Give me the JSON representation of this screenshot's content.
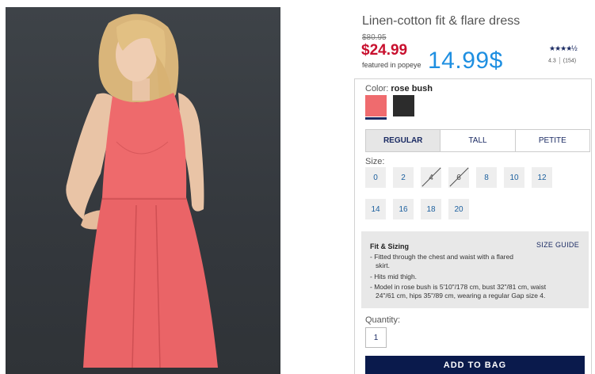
{
  "product": {
    "title": "Linen-cotton fit & flare dress",
    "original_price": "$80.95",
    "sale_price": "$24.99",
    "featured_note": "featured in popeye",
    "promo_price": "14.99$",
    "rating": {
      "stars_glyph": "★★★★½",
      "score": "4.3",
      "reviews": "(154)"
    }
  },
  "color": {
    "label": "Color:",
    "selected_name": "rose bush",
    "swatches": [
      {
        "name": "rose bush",
        "hex": "#ef6b6e",
        "selected": true
      },
      {
        "name": "black",
        "hex": "#2c2c2c",
        "selected": false
      }
    ]
  },
  "fit_tabs": [
    "REGULAR",
    "TALL",
    "PETITE"
  ],
  "active_fit_tab": "REGULAR",
  "sizes": {
    "label": "Size:",
    "row1": [
      "0",
      "2",
      "4",
      "6",
      "8",
      "10",
      "12"
    ],
    "row2": [
      "14",
      "16",
      "18",
      "20"
    ],
    "unavailable": [
      "4",
      "6"
    ]
  },
  "fit_sizing": {
    "heading": "Fit & Sizing",
    "size_guide": "SIZE GUIDE",
    "lines": [
      "- Fitted through the chest and waist with a flared",
      "  skirt.",
      "- Hits mid thigh.",
      "- Model in rose bush is 5'10\"/178 cm, bust 32\"/81 cm, waist",
      "  24\"/61 cm, hips 35\"/89 cm, wearing a regular Gap size 4."
    ]
  },
  "quantity": {
    "label": "Quantity:",
    "value": "1"
  },
  "add_to_bag_label": "ADD TO BAG",
  "colors": {
    "brand_navy": "#0a1a4c",
    "sale_red": "#c8102e",
    "promo_blue": "#1e8fe1"
  }
}
